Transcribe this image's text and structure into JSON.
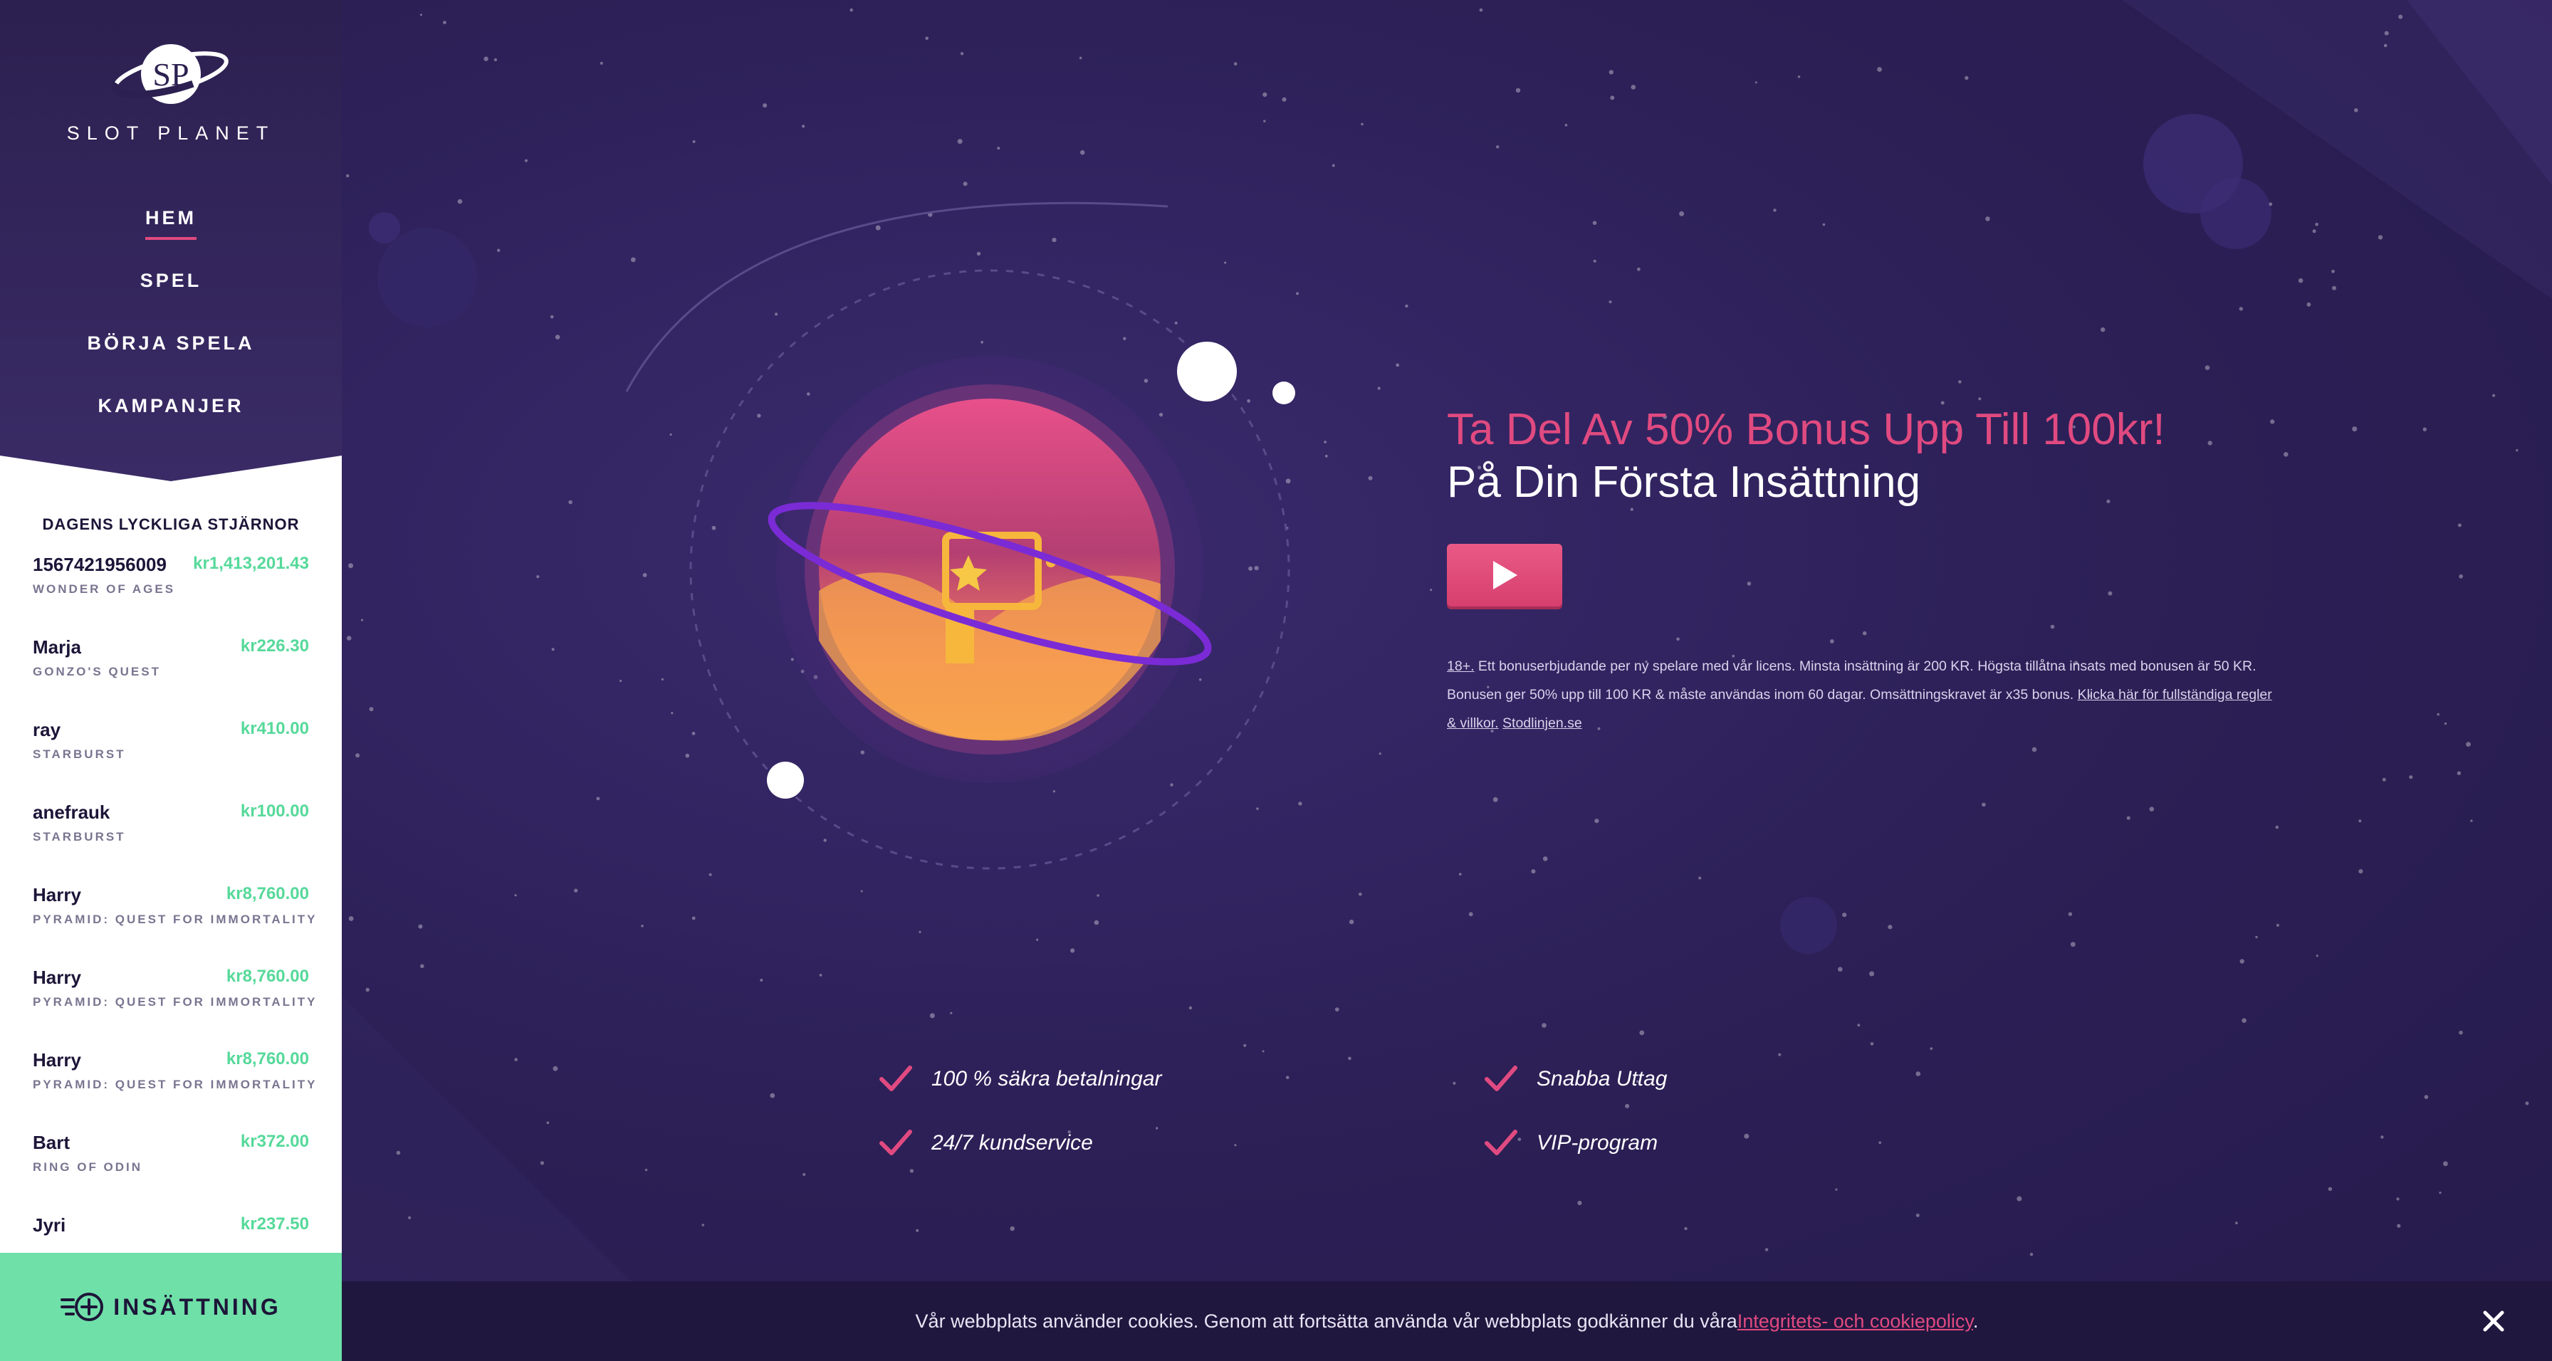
{
  "brand": {
    "name": "SLOT PLANET"
  },
  "nav": {
    "items": [
      {
        "label": "HEM",
        "active": true
      },
      {
        "label": "SPEL",
        "active": false
      },
      {
        "label": "BÖRJA SPELA",
        "active": false
      },
      {
        "label": "KAMPANJER",
        "active": false
      }
    ]
  },
  "winners": {
    "title": "DAGENS LYCKLIGA STJÄRNOR",
    "items": [
      {
        "name": "1567421956009",
        "amount": "kr1,413,201.43",
        "game": "WONDER OF AGES"
      },
      {
        "name": "Marja",
        "amount": "kr226.30",
        "game": "GONZO'S QUEST"
      },
      {
        "name": "ray",
        "amount": "kr410.00",
        "game": "STARBURST"
      },
      {
        "name": "anefrauk",
        "amount": "kr100.00",
        "game": "STARBURST"
      },
      {
        "name": "Harry",
        "amount": "kr8,760.00",
        "game": "PYRAMID: QUEST FOR IMMORTALITY"
      },
      {
        "name": "Harry",
        "amount": "kr8,760.00",
        "game": "PYRAMID: QUEST FOR IMMORTALITY"
      },
      {
        "name": "Harry",
        "amount": "kr8,760.00",
        "game": "PYRAMID: QUEST FOR IMMORTALITY"
      },
      {
        "name": "Bart",
        "amount": "kr372.00",
        "game": "RING OF ODIN"
      },
      {
        "name": "Jyri",
        "amount": "kr237.50",
        "game": ""
      }
    ]
  },
  "deposit": {
    "label": "INSÄTTNING"
  },
  "promo": {
    "line1": "Ta Del Av 50% Bonus Upp Till 100kr!",
    "line2": "På Din Första Insättning"
  },
  "terms": {
    "age": "18+.",
    "text": " Ett bonuserbjudande per ny spelare med vår licens. Minsta insättning är 200 KR. Högsta tillåtna insats med bonusen är 50 KR. Bonusen ger 50% upp till 100 KR & måste användas inom 60 dagar. Omsättningskravet är x35 bonus. ",
    "link1": "Klicka här för fullständiga regler & villkor.",
    "link2": "Stodlinjen.se"
  },
  "features": [
    "100 % säkra betalningar",
    "Snabba Uttag",
    "24/7 kundservice",
    "VIP-program"
  ],
  "cookie": {
    "text": "Vår webbplats använder cookies. Genom att fortsätta använda vår webbplats godkänner du våra",
    "link": "Integritets- och cookiepolicy",
    "end": "."
  },
  "colors": {
    "accent_pink": "#e04a80",
    "win_green": "#56d99a",
    "deposit_green": "#6fe0a8",
    "bg_purple": "#2b1f52"
  }
}
